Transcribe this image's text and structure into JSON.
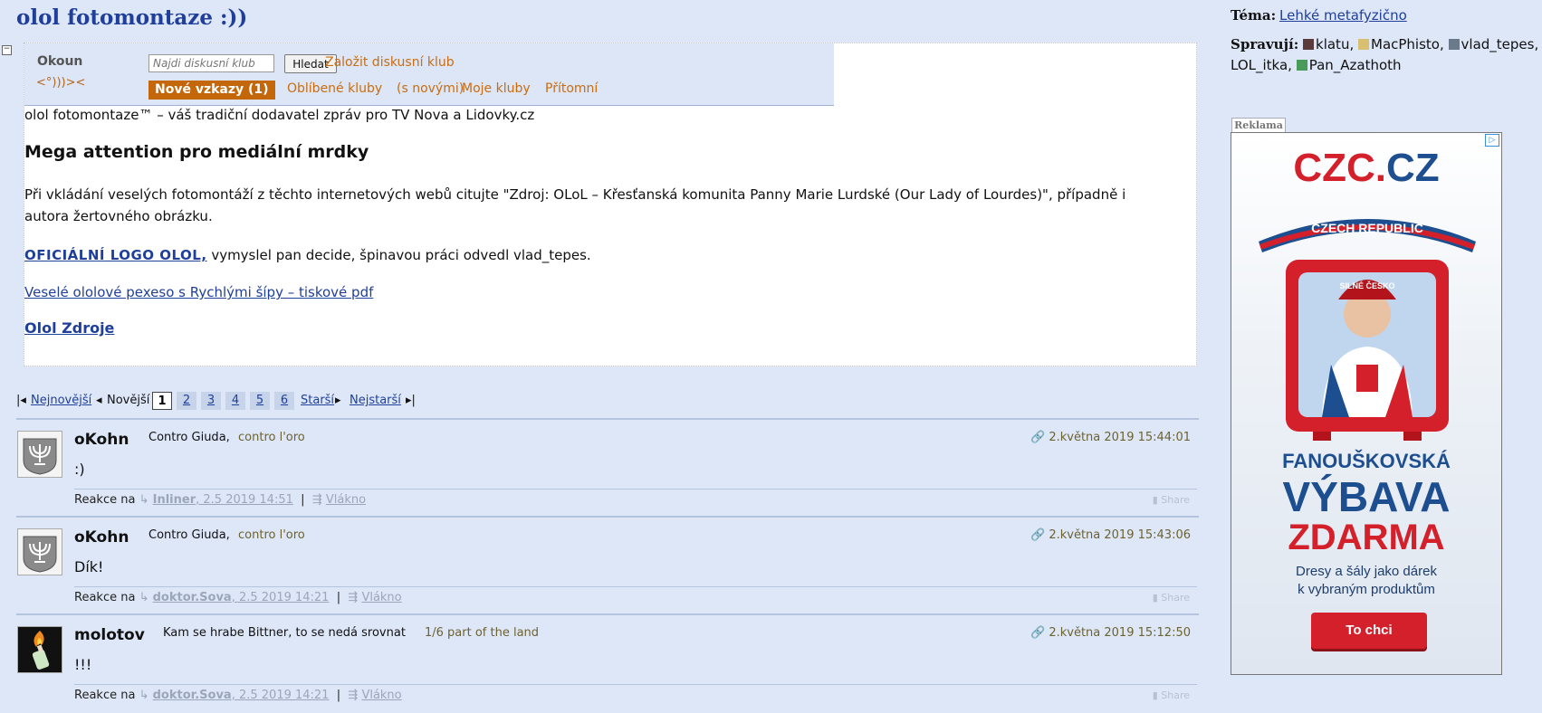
{
  "club": {
    "title": "olol fotomontaze :))",
    "intro": "olol fotomontaze™ – váš tradiční dodavatel zpráv pro TV Nova a Lidovky.cz",
    "heading": "Mega attention pro mediální mrdky",
    "paragraph": "Při vkládání veselých fotomontáží z těchto internetových webů citujte \"Zdroj: OLoL – Křesťanská komunita Panny Marie Lurdské (Our Lady of Lourdes)\", případně i autora žertovného obrázku.",
    "logo_link": "OFICIÁLNÍ LOGO OLOL,",
    "logo_rest": " vymyslel pan decide, špinavou práci odvedl vlad_tepes.",
    "pexeso_link": "Veselé ololové pexeso s Rychlými šípy – tiskové pdf",
    "zdroje_link": "Olol Zdroje"
  },
  "okoun": {
    "logo_name": "Okoun",
    "logo_fish": "<°)))><",
    "search_placeholder": "Najdi diskusní klub",
    "search_button": "Hledat",
    "create_club": "Založit diskusní klub",
    "new_messages": "Nové vzkazy (1)",
    "favorite_clubs": "Oblíbené kluby",
    "with_new": "(s novými)",
    "my_clubs": "Moje kluby",
    "present": "Přítomní"
  },
  "pagination": {
    "newest": "Nejnovější",
    "newer": "Novější",
    "pages": [
      "1",
      "2",
      "3",
      "4",
      "5",
      "6"
    ],
    "current": "1",
    "older": "Starší",
    "oldest": "Nejstarší"
  },
  "posts": [
    {
      "author": "oKohn",
      "motto": "Contro Giuda,",
      "motto2": "contro l'oro",
      "date": "2.května 2019 15:44:01",
      "body": ":)",
      "reply_prefix": "Reakce na",
      "reply_user": "Inliner",
      "reply_date": ", 2.5 2019 14:51",
      "thread": "Vlákno",
      "share": "Share"
    },
    {
      "author": "oKohn",
      "motto": "Contro Giuda,",
      "motto2": "contro l'oro",
      "date": "2.května 2019 15:43:06",
      "body": "Dík!",
      "reply_prefix": "Reakce na",
      "reply_user": "doktor.Sova",
      "reply_date": ", 2.5 2019 14:21",
      "thread": "Vlákno",
      "share": "Share"
    },
    {
      "author": "molotov",
      "motto": "Kam se hrabe Bittner, to se nedá srovnat",
      "motto2": "1/6 part of the land",
      "date": "2.května 2019 15:12:50",
      "body": "!!!",
      "reply_prefix": "Reakce na",
      "reply_user": "doktor.Sova",
      "reply_date": ", 2.5 2019 14:21",
      "thread": "Vlákno",
      "share": "Share"
    }
  ],
  "sidebar": {
    "topic_label": "Téma:",
    "topic": "Lehké metafyzično",
    "admins_label": "Spravují:",
    "admins": [
      "klatu",
      "MacPhisto",
      "vlad_tepes",
      "LOL_itka",
      "Pan_Azathoth"
    ]
  },
  "ad": {
    "label": "Reklama",
    "logo_czc": "CZC.",
    "logo_cz": "CZ",
    "scarf": "CZECH REPUBLIC",
    "cap": "SILNÉ ČESKO",
    "line1": "FANOUŠKOVSKÁ",
    "line2": "VÝBAVA",
    "line3": "ZDARMA",
    "sub1": "Dresy a šály jako dárek",
    "sub2": "k vybraným produktům",
    "cta": "To chci",
    "colors": {
      "red": "#d4202b",
      "blue": "#1d4e8f"
    }
  },
  "colors": {
    "page_bg": "#dde7f8",
    "link": "#1f3f9a",
    "accent": "#c4670a"
  }
}
